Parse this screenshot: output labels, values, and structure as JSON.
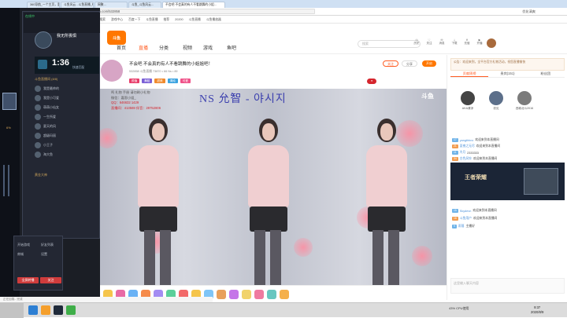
{
  "browser": {
    "tabs": [
      "360导航_一个主页，整个世界",
      "斗鱼风云 - 斗鱼直播_每天都...",
      "网聚...",
      "斗鱼_斗鱼风云...",
      "不会吧 不会真的有人不看跳舞的小姐..."
    ],
    "url": "https://www.douyu.com/532858",
    "bookmarks": [
      "360搜索",
      "游戏中心",
      "百度一下",
      "斗鱼直播",
      "推荐",
      "20200",
      "斗鱼直播",
      "斗鱼播放器",
      "斗鱼之家",
      "斗鱼中心"
    ],
    "right_user": "优化清爽"
  },
  "site": {
    "logo": "斗鱼",
    "nav": [
      "首页",
      "直播",
      "分类",
      "视频",
      "游戏",
      "鱼吧"
    ],
    "search_placeholder": "搜索",
    "header_icons": [
      "历史",
      "关注",
      "消息",
      "下载",
      "充值",
      "开播"
    ]
  },
  "stream": {
    "title": "不会吧 不会真的有人不看跳舞的小姐姐吧！",
    "id_line": "532858 斗鱼直播 73870 • 66 Ns • 89",
    "tags": [
      "颜值",
      "舞蹈",
      "甜美",
      "清纯",
      "可爱"
    ],
    "tag_colors": [
      "#e83d6a",
      "#7a5fd6",
      "#f08a2d",
      "#3aa3e0",
      "#ef5289"
    ],
    "follow": "关注",
    "share": "分享",
    "hot": "开启"
  },
  "video": {
    "title_text": "NS  允智  - 야시지",
    "info_lines": [
      "鸣 礼物 手册 请勿刷小礼物",
      "微信：嘉恩小姐_",
      "QQ：646632 1429",
      "直播间：413569 伴音：29752806"
    ],
    "logo": "斗鱼"
  },
  "overlay": {
    "title": "我无所畏惧",
    "subtitle": "在线中",
    "timer": "1:36",
    "timer_sub": "快速匹配",
    "section": "斗鱼直播间 (8/8)",
    "list": [
      "我是最帅的",
      "我是小可爱",
      "萌萌小仙女",
      "一生所爱",
      "夏天的风",
      "超级玛丽",
      "小王子",
      "海大鱼"
    ],
    "rank_label": "黄金大神",
    "ks_label": "6%",
    "buttons": [
      "全屏转播",
      "关注"
    ],
    "menu": [
      "开始游戏",
      "好友列表",
      "商城",
      "设置"
    ]
  },
  "panel": {
    "notice": "公告：欢迎来到，全平台官方礼物活动，祝您直播愉快",
    "tabs": [
      "贡献周榜",
      "贵宾(151)",
      "粉丝团"
    ],
    "ranks": [
      {
        "name": "AKA清凉",
        "level": "1"
      },
      {
        "name": "初见",
        "level": "2"
      },
      {
        "name": "西城北斗2016",
        "level": "3"
      }
    ],
    "messages": [
      {
        "lv": "17",
        "user": "yangthhnx",
        "text": "欢迎来到本直播间"
      },
      {
        "lv": "21",
        "user": "夏夜之无尽",
        "text": "欢迎来到本直播间"
      },
      {
        "lv": "11",
        "user": "冷月",
        "text": "2333333"
      },
      {
        "lv": "34",
        "user": "白色风铃",
        "text": "欢迎来到本直播间"
      },
      {
        "lv": "15",
        "user": "Skydevn",
        "text": "欢迎来到本直播间"
      },
      {
        "lv": "18",
        "user": "斗鱼用户",
        "text": "欢迎来到本直播间"
      },
      {
        "lv": "9",
        "user": "雨落",
        "text": "主播好"
      }
    ],
    "ad_text": "王者荣耀",
    "chat_placeholder": "这里输入聊天内容"
  },
  "taskbar": {
    "time": "9:37",
    "date": "2020/8/9",
    "cpu": "43% CPU使用",
    "status": "正在加载...完成"
  }
}
